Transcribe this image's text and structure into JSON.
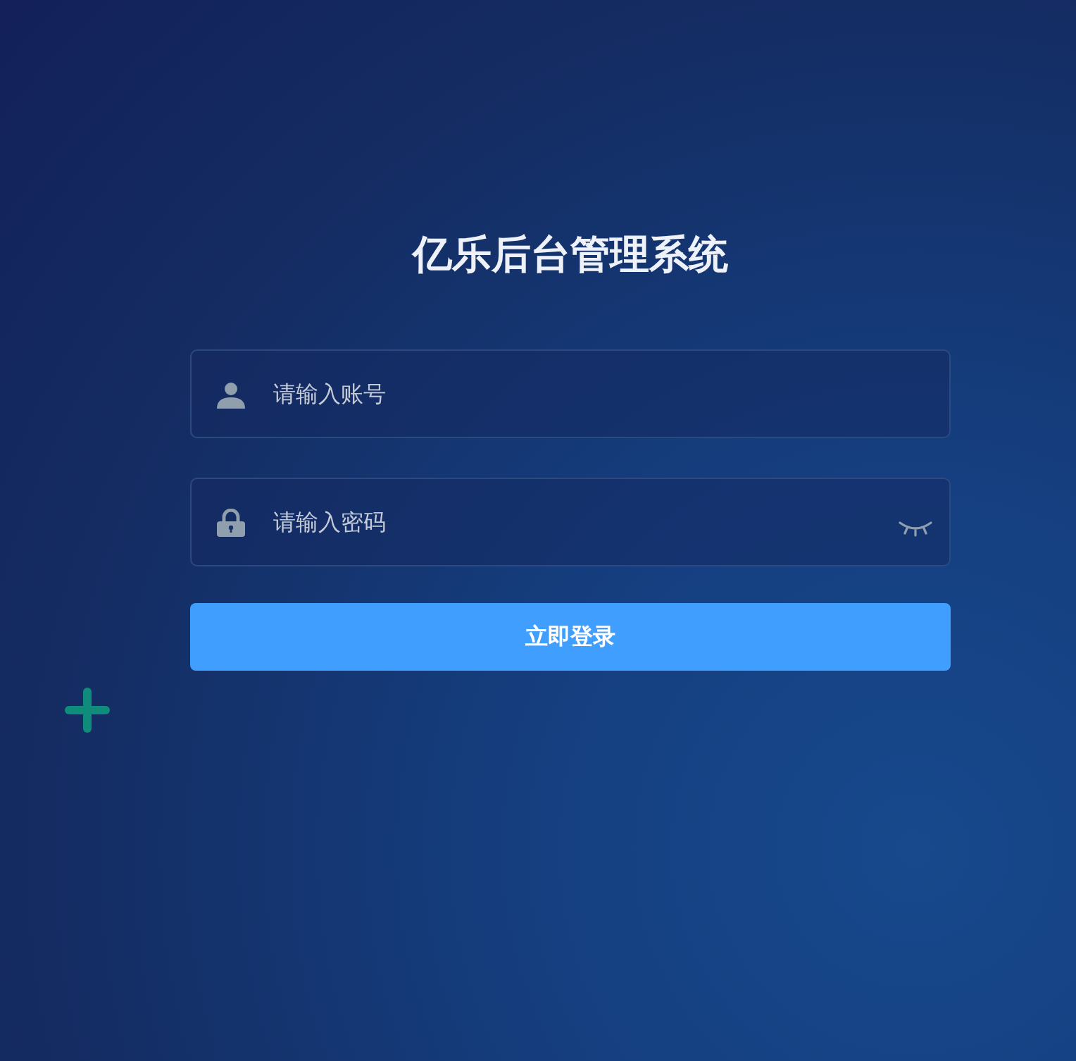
{
  "title": "亿乐后台管理系统",
  "username": {
    "placeholder": "请输入账号"
  },
  "password": {
    "placeholder": "请输入密码"
  },
  "login_button": "立即登录"
}
